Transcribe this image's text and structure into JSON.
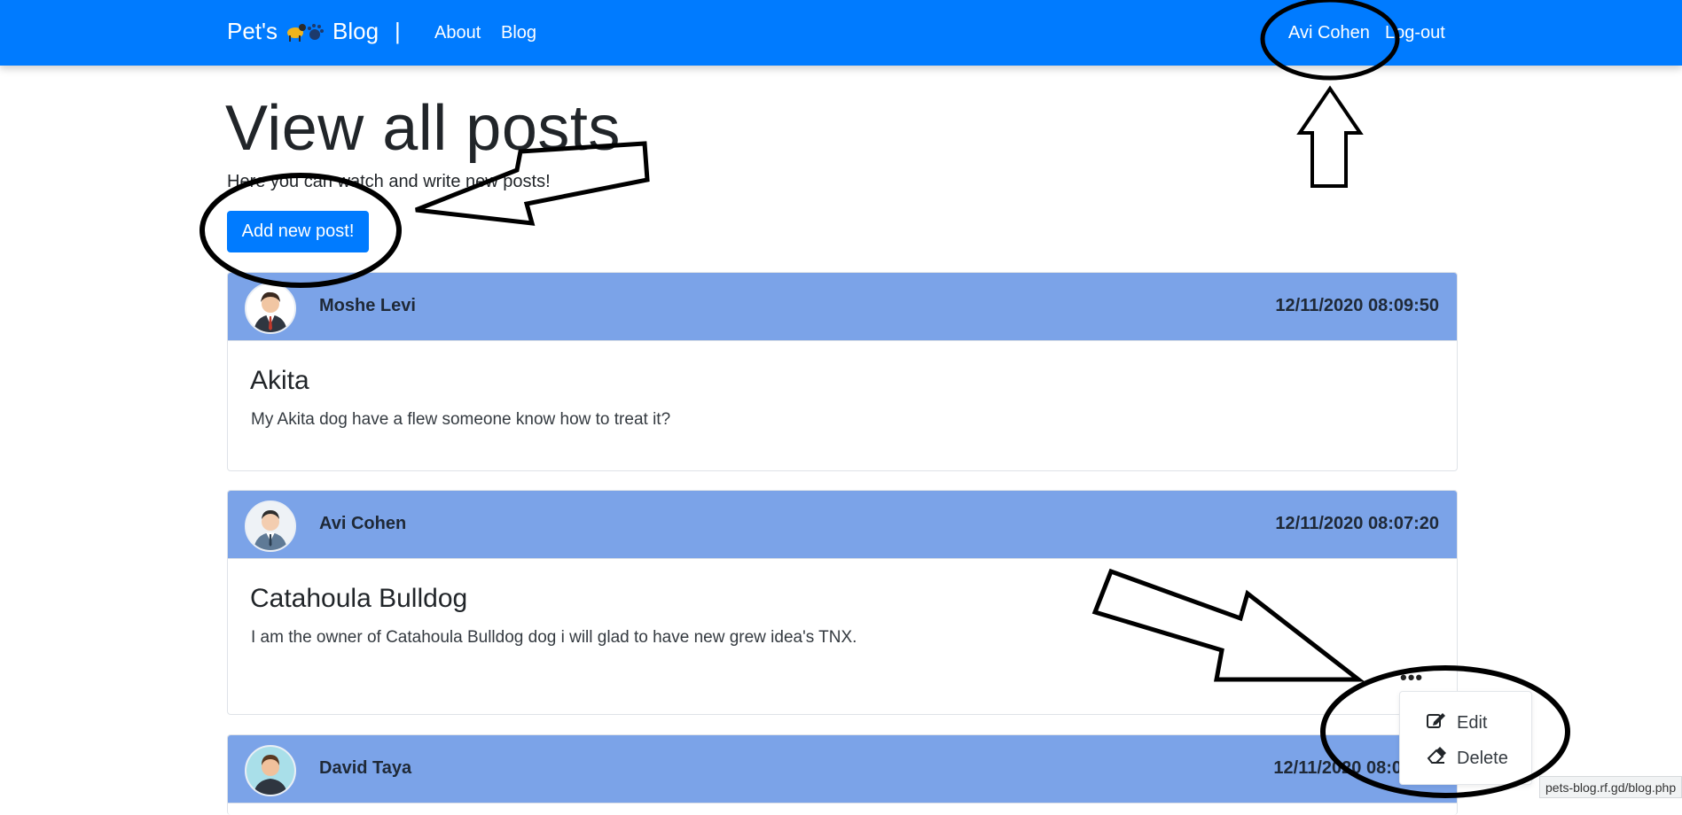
{
  "navbar": {
    "brand_left": "Pet's",
    "brand_right": "Blog",
    "brand_separator": "|",
    "links": [
      "About",
      "Blog"
    ],
    "user_name": "Avi Cohen",
    "logout_label": "Log-out"
  },
  "page": {
    "title": "View all posts",
    "subtitle": "Here you can watch and write new posts!",
    "add_button": "Add new post!"
  },
  "posts": [
    {
      "author": "Moshe Levi",
      "date": "12/11/2020 08:09:50",
      "title": "Akita",
      "body": "My Akita dog have a flew someone know how to treat it?"
    },
    {
      "author": "Avi Cohen",
      "date": "12/11/2020 08:07:20",
      "title": "Catahoula Bulldog",
      "body": "I am the owner of Catahoula Bulldog dog i will glad to have new grew idea's TNX."
    },
    {
      "author": "David Taya",
      "date": "12/11/2020 08:0"
    }
  ],
  "post_menu": {
    "trigger": "•••",
    "items": [
      {
        "label": "Edit",
        "icon": "edit-icon"
      },
      {
        "label": "Delete",
        "icon": "eraser-icon"
      }
    ]
  },
  "status_bar": {
    "url": "pets-blog.rf.gd/blog.php"
  },
  "colors": {
    "navbar": "#007bff",
    "card_header": "#7ba3e8",
    "button": "#007bff"
  }
}
